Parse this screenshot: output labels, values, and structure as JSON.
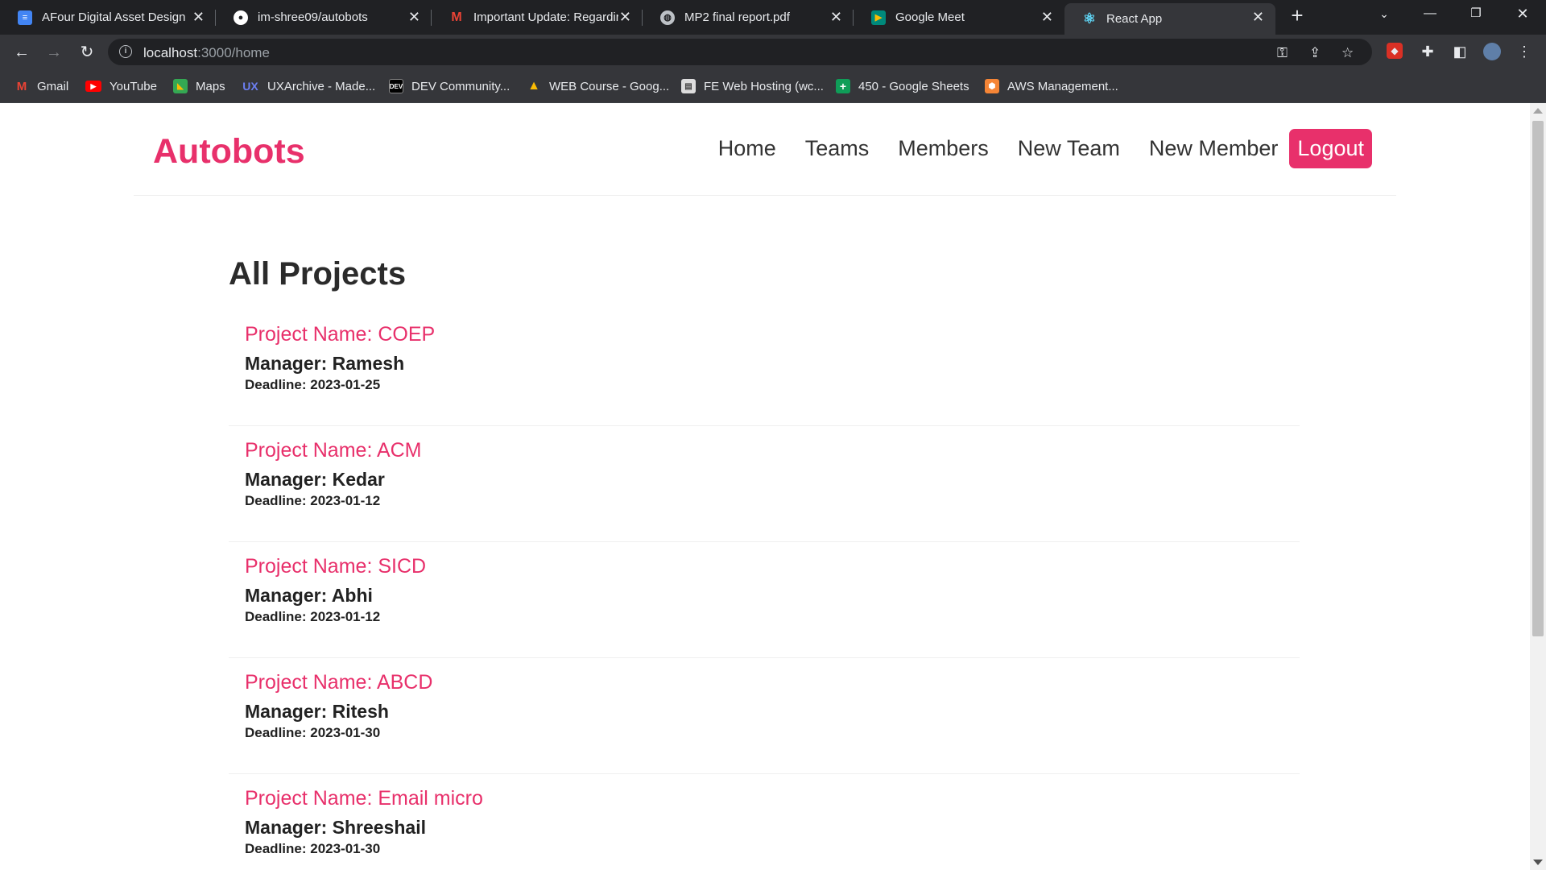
{
  "browser": {
    "tabs": [
      {
        "title": "AFour Digital Asset Design",
        "icon": "docs-icon",
        "color": "#4285f4"
      },
      {
        "title": "im-shree09/autobots",
        "icon": "github-icon",
        "color": "#ffffff"
      },
      {
        "title": "Important Update: Regardir",
        "icon": "gmail-icon",
        "color": "#ea4335"
      },
      {
        "title": "MP2 final report.pdf",
        "icon": "globe-icon",
        "color": "#bdc1c6"
      },
      {
        "title": "Google Meet",
        "icon": "meet-icon",
        "color": "#00897b"
      },
      {
        "title": "React App",
        "icon": "react-icon",
        "color": "#61dafb"
      }
    ],
    "url_host": "localhost",
    "url_path": ":3000/home",
    "bookmarks": [
      {
        "label": "Gmail",
        "icon": "gmail-icon"
      },
      {
        "label": "YouTube",
        "icon": "youtube-icon"
      },
      {
        "label": "Maps",
        "icon": "maps-icon"
      },
      {
        "label": "UXArchive - Made...",
        "icon": "ux-icon"
      },
      {
        "label": "DEV Community...",
        "icon": "dev-icon"
      },
      {
        "label": "WEB Course - Goog...",
        "icon": "drive-icon"
      },
      {
        "label": "FE Web Hosting (wc...",
        "icon": "doc-thumb-icon"
      },
      {
        "label": "450 - Google Sheets",
        "icon": "sheets-icon"
      },
      {
        "label": "AWS Management...",
        "icon": "aws-icon"
      }
    ]
  },
  "app": {
    "brand": "Autobots",
    "brand_color": "#e8306b",
    "nav": {
      "home": "Home",
      "teams": "Teams",
      "members": "Members",
      "new_team": "New Team",
      "new_member": "New Member",
      "logout": "Logout"
    },
    "heading": "All Projects",
    "projects": [
      {
        "name": "Project Name: COEP",
        "manager": "Manager: Ramesh",
        "deadline": "Deadline: 2023-01-25"
      },
      {
        "name": "Project Name: ACM",
        "manager": "Manager: Kedar",
        "deadline": "Deadline: 2023-01-12"
      },
      {
        "name": "Project Name: SICD",
        "manager": "Manager: Abhi",
        "deadline": "Deadline: 2023-01-12"
      },
      {
        "name": "Project Name: ABCD",
        "manager": "Manager: Ritesh",
        "deadline": "Deadline: 2023-01-30"
      },
      {
        "name": "Project Name: Email micro",
        "manager": "Manager: Shreeshail",
        "deadline": "Deadline: 2023-01-30"
      }
    ]
  }
}
